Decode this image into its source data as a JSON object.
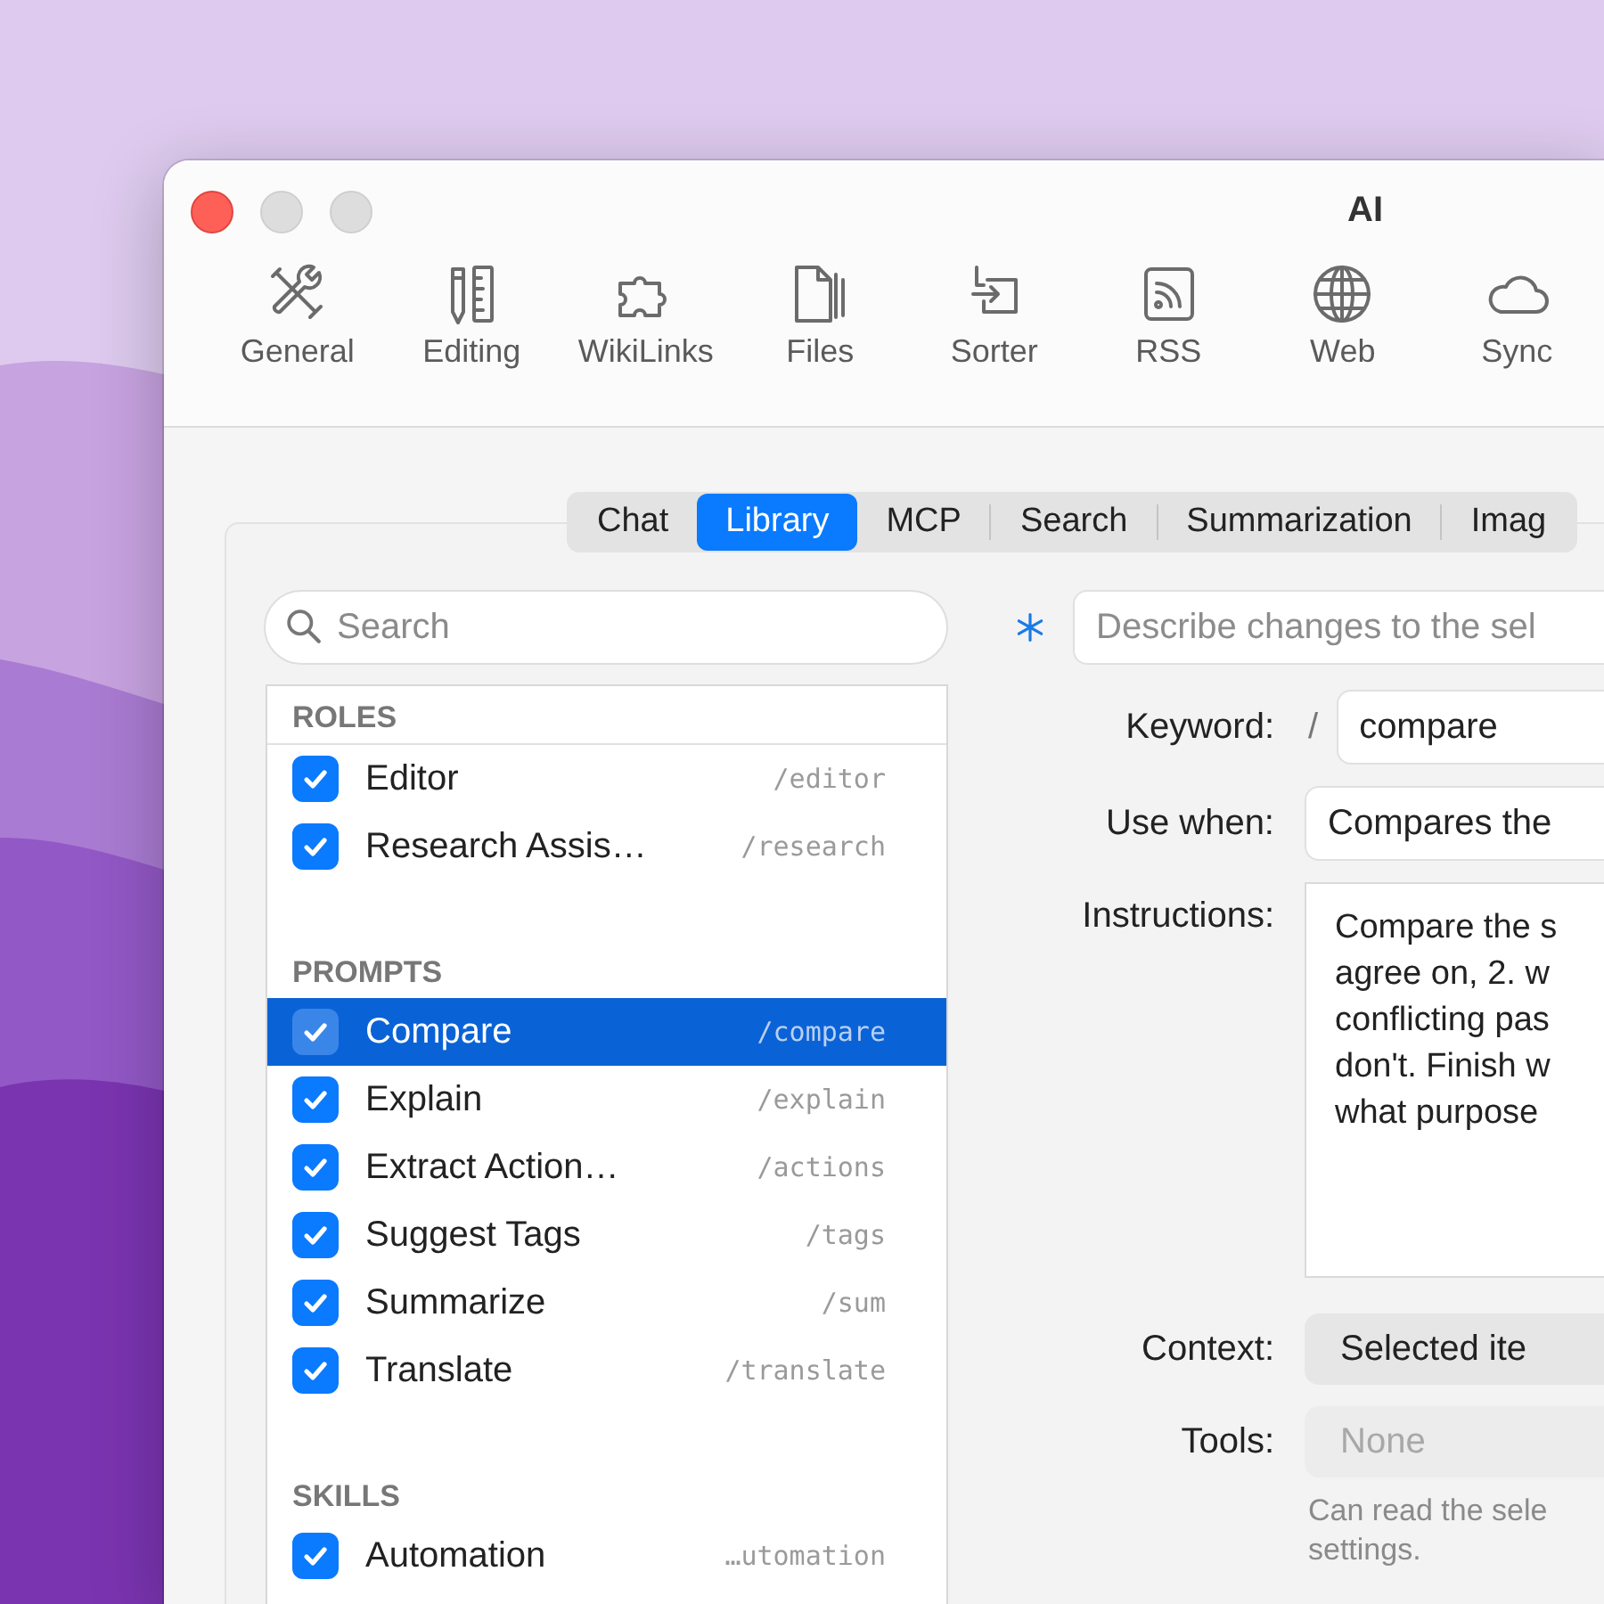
{
  "window": {
    "title": "AI"
  },
  "toolbar": [
    {
      "label": "General",
      "selected": false
    },
    {
      "label": "Editing",
      "selected": false
    },
    {
      "label": "WikiLinks",
      "selected": false
    },
    {
      "label": "Files",
      "selected": false
    },
    {
      "label": "Sorter",
      "selected": false
    },
    {
      "label": "RSS",
      "selected": false
    },
    {
      "label": "Web",
      "selected": false
    },
    {
      "label": "Sync",
      "selected": false
    }
  ],
  "tabs": [
    {
      "label": "Chat",
      "selected": false
    },
    {
      "label": "Library",
      "selected": true
    },
    {
      "label": "MCP",
      "selected": false
    },
    {
      "label": "Search",
      "selected": false
    },
    {
      "label": "Summarization",
      "selected": false
    },
    {
      "label": "Imag",
      "selected": false
    }
  ],
  "search": {
    "placeholder": "Search"
  },
  "sections": [
    {
      "title": "ROLES",
      "items": [
        {
          "name": "Editor",
          "keyword": "/editor",
          "checked": true,
          "selected": false
        },
        {
          "name": "Research Assis…",
          "keyword": "/research",
          "checked": true,
          "selected": false
        }
      ]
    },
    {
      "title": "PROMPTS",
      "items": [
        {
          "name": "Compare",
          "keyword": "/compare",
          "checked": true,
          "selected": true
        },
        {
          "name": "Explain",
          "keyword": "/explain",
          "checked": true,
          "selected": false
        },
        {
          "name": "Extract Action…",
          "keyword": "/actions",
          "checked": true,
          "selected": false
        },
        {
          "name": "Suggest Tags",
          "keyword": "/tags",
          "checked": true,
          "selected": false
        },
        {
          "name": "Summarize",
          "keyword": "/sum",
          "checked": true,
          "selected": false
        },
        {
          "name": "Translate",
          "keyword": "/translate",
          "checked": true,
          "selected": false
        }
      ]
    },
    {
      "title": "SKILLS",
      "items": [
        {
          "name": "Automation",
          "keyword": "…utomation",
          "checked": true,
          "selected": false
        }
      ]
    }
  ],
  "ai_prompt": {
    "placeholder": "Describe changes to the sel"
  },
  "form": {
    "keyword": {
      "label": "Keyword:",
      "prefix": "/",
      "value": "compare"
    },
    "use_when": {
      "label": "Use when:",
      "value": "Compares the"
    },
    "instructions": {
      "label": "Instructions:",
      "lines": [
        "Compare the s",
        "agree on, 2. w",
        "conflicting pas",
        "don't. Finish w",
        "what purpose"
      ]
    },
    "context": {
      "label": "Context:",
      "value": "Selected ite",
      "disabled": false
    },
    "tools": {
      "label": "Tools:",
      "value": "None",
      "disabled": true
    },
    "help_lines": [
      "Can read the sele",
      "settings."
    ]
  }
}
